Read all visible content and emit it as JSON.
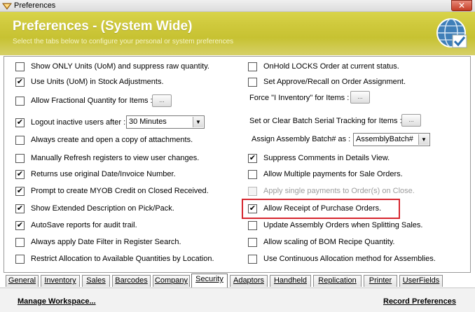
{
  "window": {
    "title": "Preferences",
    "close_glyph": "✕"
  },
  "banner": {
    "heading": "Preferences - (System Wide)",
    "subtitle": "Select the tabs below to configure your personal or system preferences",
    "icon": "globe-check-icon"
  },
  "left_options": [
    {
      "label": "Show ONLY Units (UoM) and suppress raw quantity.",
      "checked": false
    },
    {
      "label": "Use Units (UoM) in Stock Adjustments.",
      "checked": true
    },
    {
      "label": "Allow Fractional Quantity for Items :",
      "checked": false
    },
    {
      "label": "Logout inactive users after :",
      "checked": true
    },
    {
      "label": "Always create and open a copy of attachments.",
      "checked": false
    },
    {
      "label": "Manually Refresh registers to view user changes.",
      "checked": false
    },
    {
      "label": "Returns use original Date/Invoice Number.",
      "checked": true
    },
    {
      "label": "Prompt to create MYOB Credit on Closed Received.",
      "checked": true
    },
    {
      "label": "Show Extended Description on Pick/Pack.",
      "checked": true
    },
    {
      "label": "AutoSave reports for audit trail.",
      "checked": true
    },
    {
      "label": "Always apply Date Filter in Register Search.",
      "checked": false
    },
    {
      "label": "Restrict Allocation to Available Quantities by Location.",
      "checked": false
    }
  ],
  "right_options": [
    {
      "label": "OnHold LOCKS Order at current status.",
      "checked": false
    },
    {
      "label": "Set Approve/Recall on Order Assignment.",
      "checked": false
    },
    {
      "label": "Suppress Comments in Details View.",
      "checked": true
    },
    {
      "label": "Allow Multiple payments for Sale Orders.",
      "checked": false
    },
    {
      "label": "Apply single payments to Order(s) on Close.",
      "checked": false,
      "disabled": true
    },
    {
      "label": "Allow Receipt of Purchase Orders.",
      "checked": true
    },
    {
      "label": "Update Assembly Orders when Splitting Sales.",
      "checked": false
    },
    {
      "label": "Allow scaling of BOM Recipe Quantity.",
      "checked": false
    },
    {
      "label": "Use Continuous Allocation method for Assemblies.",
      "checked": false
    }
  ],
  "labels": {
    "force_inventory": "Force \"I Inventory\" for Items :",
    "batch_serial": "Set or Clear Batch Serial Tracking for Items :",
    "assembly_batch": "Assign Assembly Batch# as :"
  },
  "buttons": {
    "ellipsis": "..."
  },
  "selects": {
    "logout_timeout": "30 Minutes",
    "assembly_batch": "AssemblyBatch#",
    "arrow_glyph": "▼"
  },
  "check_glyph": "✔",
  "tabs": [
    "General",
    "Inventory",
    "Sales",
    "Barcodes",
    "Company",
    "Security",
    "Adaptors",
    "Handheld",
    "Replication",
    "Printer",
    "UserFields"
  ],
  "active_tab": "Security",
  "footer": {
    "manage_workspace": "Manage Workspace...",
    "record_preferences": "Record Preferences"
  }
}
